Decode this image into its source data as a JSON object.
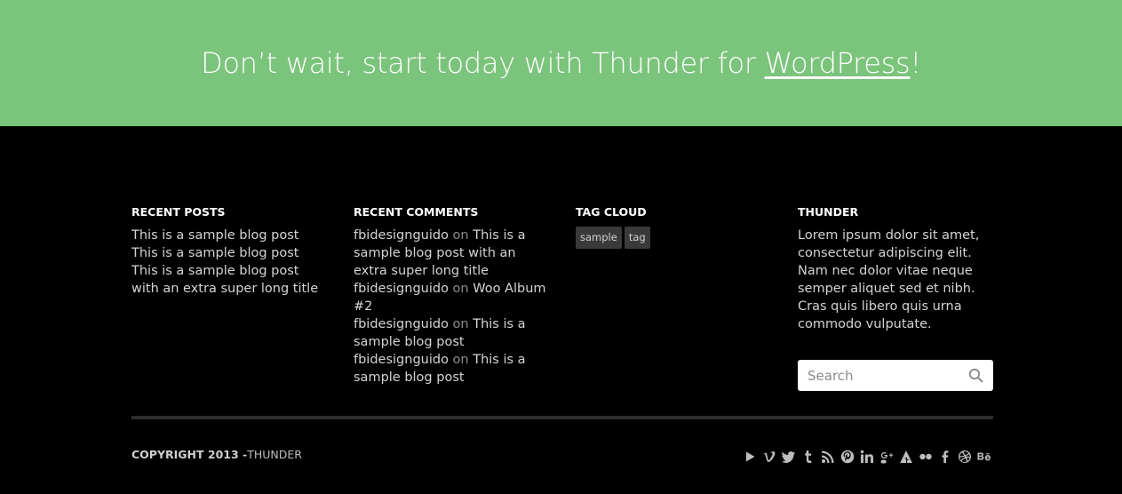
{
  "cta": {
    "text_before": "Don’t wait, start today with Thunder for ",
    "link_text": "WordPress",
    "text_after": "!"
  },
  "widgets": {
    "recent_posts": {
      "title": "RECENT POSTS",
      "items": [
        "This is a sample blog post",
        "This is a sample blog post",
        "This is a sample blog post with an extra super long title"
      ]
    },
    "recent_comments": {
      "title": "RECENT COMMENTS",
      "items": [
        {
          "author": "fbidesignguido",
          "on": "on",
          "post": "This is a sample blog post with an extra super long title"
        },
        {
          "author": "fbidesignguido",
          "on": "on",
          "post": "Woo Album #2"
        },
        {
          "author": "fbidesignguido",
          "on": "on",
          "post": "This is a sample blog post"
        },
        {
          "author": "fbidesignguido",
          "on": "on",
          "post": "This is a sample blog post"
        }
      ]
    },
    "tag_cloud": {
      "title": "TAG CLOUD",
      "tags": [
        "sample",
        "tag"
      ]
    },
    "about": {
      "title": "THUNDER",
      "text": "Lorem ipsum dolor sit amet, consectetur adipiscing elit. Nam nec dolor vitae neque semper aliquet sed et nibh. Cras quis libero quis urna commodo vulputate."
    },
    "search": {
      "placeholder": "Search"
    }
  },
  "footer": {
    "copyright": "COPYRIGHT 2013 -",
    "brand": "THUNDER"
  },
  "social_icons": [
    "youtube-icon",
    "vimeo-icon",
    "twitter-icon",
    "tumblr-icon",
    "rss-icon",
    "pinterest-icon",
    "linkedin-icon",
    "googleplus-icon",
    "forrst-icon",
    "flickr-icon",
    "facebook-icon",
    "dribbble-icon",
    "behance-icon"
  ],
  "colors": {
    "cta_background": "#7bc47c",
    "footer_background": "#000000"
  }
}
